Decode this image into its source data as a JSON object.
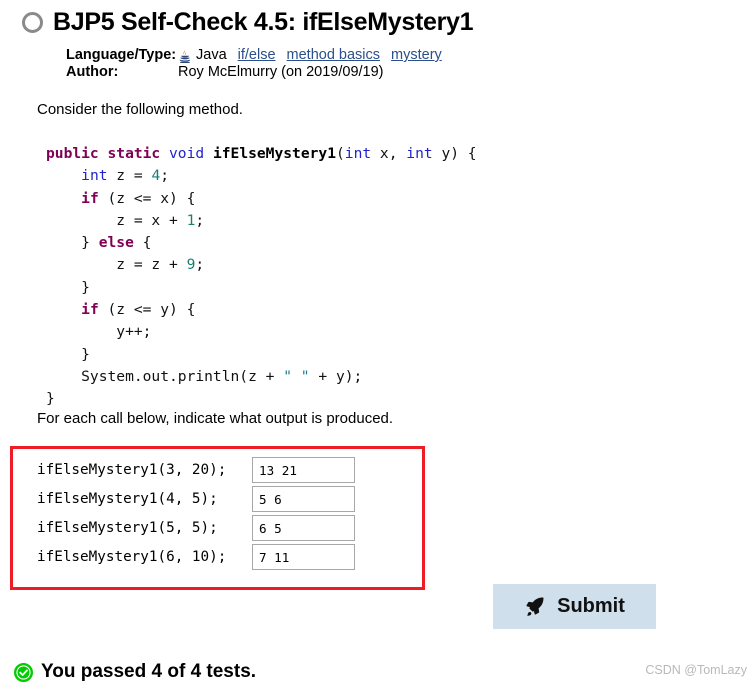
{
  "header": {
    "status_icon": "empty-circle-icon",
    "title": "BJP5 Self-Check 4.5: ifElseMystery1"
  },
  "meta": {
    "language_label": "Language/Type:",
    "language_icon": "java-coffee-cup-icon",
    "language_value": "Java",
    "tags": [
      "if/else",
      "method basics",
      "mystery"
    ],
    "author_label": "Author:",
    "author_value": "Roy McElmurry (on 2019/09/19)"
  },
  "body": {
    "intro": "Consider the following method.",
    "instruction": "For each call below, indicate what output is produced."
  },
  "code": {
    "lines": [
      [
        {
          "t": "public static ",
          "c": "k"
        },
        {
          "t": "void",
          "c": "ty"
        },
        {
          "t": " ",
          "c": ""
        },
        {
          "t": "ifElseMystery1",
          "c": "fn"
        },
        {
          "t": "(",
          "c": ""
        },
        {
          "t": "int",
          "c": "ty"
        },
        {
          "t": " x, ",
          "c": ""
        },
        {
          "t": "int",
          "c": "ty"
        },
        {
          "t": " y) {",
          "c": ""
        }
      ],
      [
        {
          "t": "    ",
          "c": ""
        },
        {
          "t": "int",
          "c": "ty"
        },
        {
          "t": " z = ",
          "c": ""
        },
        {
          "t": "4",
          "c": "num"
        },
        {
          "t": ";",
          "c": ""
        }
      ],
      [
        {
          "t": "    ",
          "c": ""
        },
        {
          "t": "if",
          "c": "k"
        },
        {
          "t": " (z <= x) {",
          "c": ""
        }
      ],
      [
        {
          "t": "        z = x + ",
          "c": ""
        },
        {
          "t": "1",
          "c": "num"
        },
        {
          "t": ";",
          "c": ""
        }
      ],
      [
        {
          "t": "    } ",
          "c": ""
        },
        {
          "t": "else",
          "c": "k"
        },
        {
          "t": " {",
          "c": ""
        }
      ],
      [
        {
          "t": "        z = z + ",
          "c": ""
        },
        {
          "t": "9",
          "c": "num"
        },
        {
          "t": ";",
          "c": ""
        }
      ],
      [
        {
          "t": "    }",
          "c": ""
        }
      ],
      [
        {
          "t": "    ",
          "c": ""
        },
        {
          "t": "if",
          "c": "k"
        },
        {
          "t": " (z <= y) {",
          "c": ""
        }
      ],
      [
        {
          "t": "        y++;",
          "c": ""
        }
      ],
      [
        {
          "t": "    }",
          "c": ""
        }
      ],
      [
        {
          "t": "    System.out.println(z + ",
          "c": ""
        },
        {
          "t": "\" \"",
          "c": "str"
        },
        {
          "t": " + y);",
          "c": ""
        }
      ],
      [
        {
          "t": "}",
          "c": ""
        }
      ]
    ]
  },
  "calls": [
    {
      "label": "ifElseMystery1(3, 20);",
      "answer": "13 21"
    },
    {
      "label": "ifElseMystery1(4, 5);",
      "answer": "5 6"
    },
    {
      "label": "ifElseMystery1(5, 5);",
      "answer": "6 5"
    },
    {
      "label": "ifElseMystery1(6, 10);",
      "answer": "7 11"
    }
  ],
  "submit": {
    "label": "Submit",
    "icon": "rocket-icon",
    "bg_color": "#cfdfeb"
  },
  "result": {
    "icon": "green-check-circle-icon",
    "text": "You passed 4 of 4 tests.",
    "color": "#00cc00"
  },
  "watermark": {
    "text": "CSDN @TomLazy"
  },
  "highlight": {
    "border_color": "#ee1c25"
  }
}
